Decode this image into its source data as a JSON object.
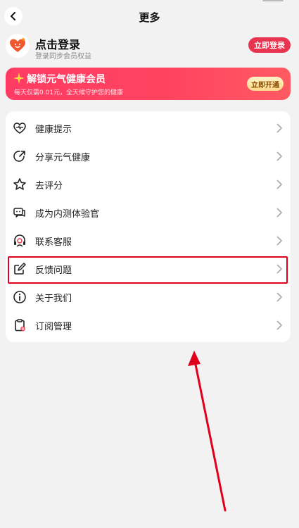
{
  "header": {
    "title": "更多"
  },
  "profile": {
    "name": "点击登录",
    "subtitle": "登录同步会员权益",
    "login_button": "立即登录"
  },
  "vip": {
    "title": "解锁元气健康会员",
    "description": "每天仅需0.01元，全天候守护您的健康",
    "button": "立即开通"
  },
  "menu": {
    "items": [
      {
        "label": "健康提示",
        "icon": "heart-icon"
      },
      {
        "label": "分享元气健康",
        "icon": "share-icon"
      },
      {
        "label": "去评分",
        "icon": "star-icon"
      },
      {
        "label": "成为内测体验官",
        "icon": "chat-icon"
      },
      {
        "label": "联系客服",
        "icon": "headset-icon"
      },
      {
        "label": "反馈问题",
        "icon": "edit-icon"
      },
      {
        "label": "关于我们",
        "icon": "info-icon"
      },
      {
        "label": "订阅管理",
        "icon": "clipboard-icon"
      }
    ]
  },
  "colors": {
    "accent": "#e8344e",
    "annotation": "#e1001b"
  }
}
